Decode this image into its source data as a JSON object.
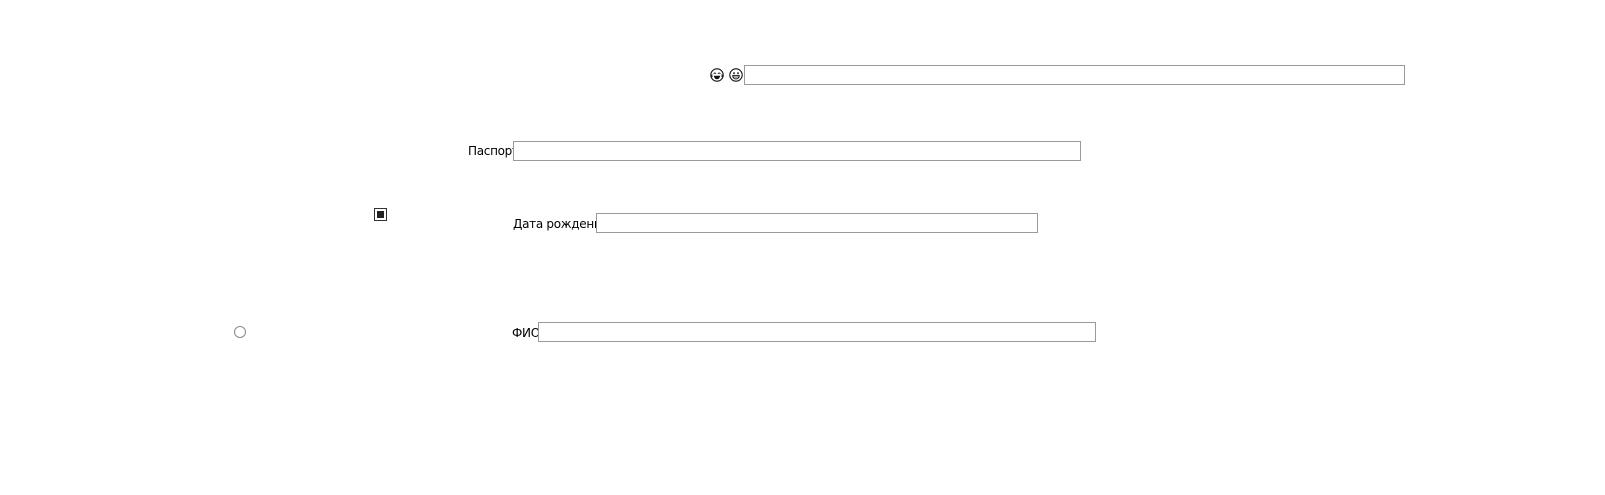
{
  "top_row": {
    "icons": [
      "face-with-tears-of-joy-icon",
      "grinning-face-icon"
    ],
    "input_value": ""
  },
  "passport": {
    "label": "Паспорт",
    "value": ""
  },
  "birth_date": {
    "label": "Дата рождения",
    "value": ""
  },
  "full_name": {
    "label": "ФИО",
    "value": ""
  },
  "checkbox": {
    "checked": true
  },
  "radio": {
    "selected": false
  }
}
